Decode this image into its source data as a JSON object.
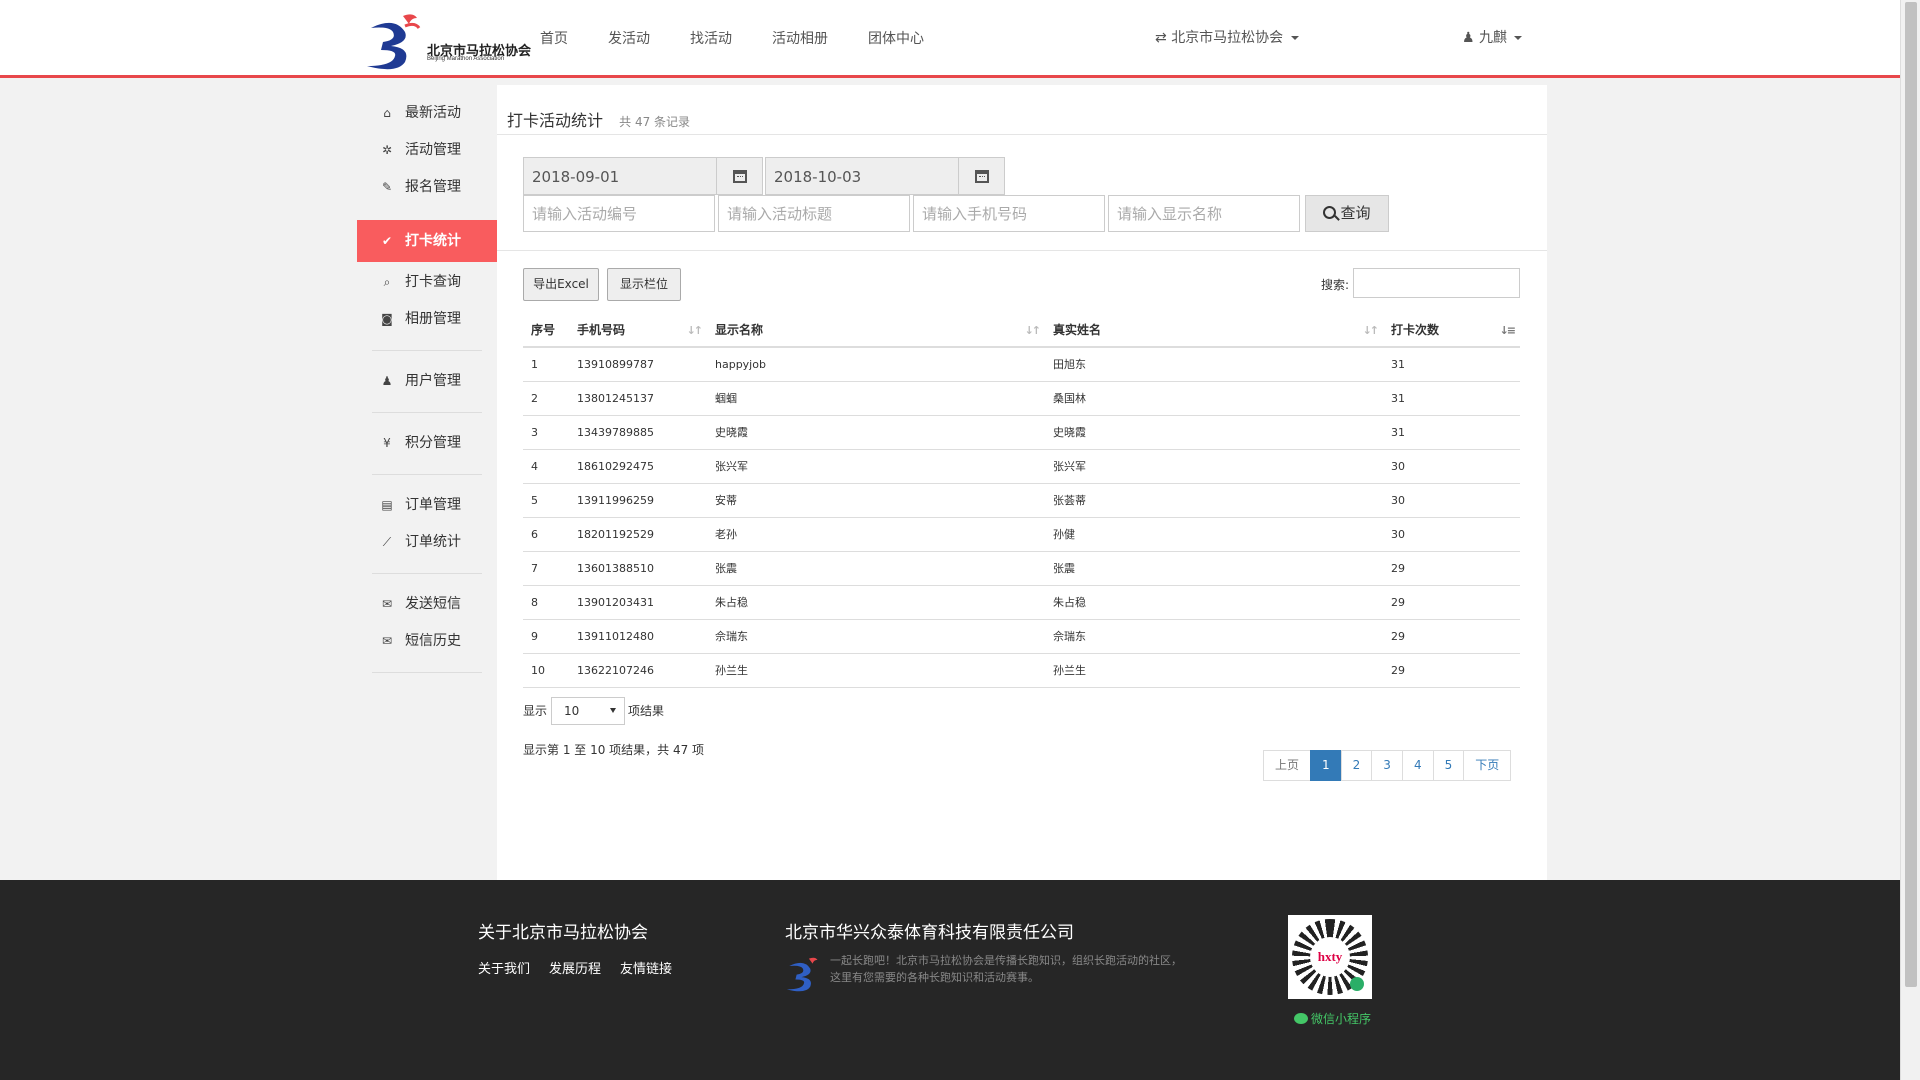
{
  "header": {
    "logo_cn": "北京市马拉松协会",
    "logo_en": "Beijing Marathon Association",
    "nav": [
      "首页",
      "发活动",
      "找活动",
      "活动相册",
      "团体中心"
    ],
    "org_switch": "北京市马拉松协会",
    "user": "九麒"
  },
  "sidebar": {
    "items": [
      {
        "label": "最新活动",
        "icon": "home-icon",
        "glyph": "⌂"
      },
      {
        "label": "活动管理",
        "icon": "gear-icon",
        "glyph": "✲"
      },
      {
        "label": "报名管理",
        "icon": "edit-icon",
        "glyph": "✎"
      },
      {
        "label": "打卡统计",
        "icon": "check-square-icon",
        "glyph": "✔"
      },
      {
        "label": "打卡查询",
        "icon": "search-icon",
        "glyph": "⌕"
      },
      {
        "label": "相册管理",
        "icon": "camera-icon",
        "glyph": "◙"
      },
      {
        "label": "用户管理",
        "icon": "user-icon",
        "glyph": "♟"
      },
      {
        "label": "积分管理",
        "icon": "yen-icon",
        "glyph": "¥"
      },
      {
        "label": "订单管理",
        "icon": "file-icon",
        "glyph": "▤"
      },
      {
        "label": "订单统计",
        "icon": "line-chart-icon",
        "glyph": "⟋"
      },
      {
        "label": "发送短信",
        "icon": "envelope-icon",
        "glyph": "✉"
      },
      {
        "label": "短信历史",
        "icon": "envelope-o-icon",
        "glyph": "✉"
      }
    ]
  },
  "panel": {
    "title": "打卡活动统计",
    "subtitle": "共 47 条记录"
  },
  "filters": {
    "start_date": "2018-09-01",
    "end_date": "2018-10-03",
    "ph_activity_no": "请输入活动编号",
    "ph_activity_title": "请输入活动标题",
    "ph_phone": "请输入手机号码",
    "ph_display_name": "请输入显示名称",
    "query": "查询"
  },
  "toolbar": {
    "export": "导出Excel",
    "columns": "显示栏位",
    "search_label": "搜索:"
  },
  "table": {
    "headers": [
      "序号",
      "手机号码",
      "显示名称",
      "真实姓名",
      "打卡次数"
    ],
    "rows": [
      [
        "1",
        "13910899787",
        "happyjob",
        "田旭东",
        "31"
      ],
      [
        "2",
        "13801245137",
        "蝈蝈",
        "桑国林",
        "31"
      ],
      [
        "3",
        "13439789885",
        "史晓霞",
        "史晓霞",
        "31"
      ],
      [
        "4",
        "18610292475",
        "张兴军",
        "张兴军",
        "30"
      ],
      [
        "5",
        "13911996259",
        "安蒂",
        "张荟蒂",
        "30"
      ],
      [
        "6",
        "18201192529",
        "老孙",
        "孙健",
        "30"
      ],
      [
        "7",
        "13601388510",
        "张震",
        "张震",
        "29"
      ],
      [
        "8",
        "13901203431",
        "朱占稳",
        "朱占稳",
        "29"
      ],
      [
        "9",
        "13911012480",
        "佘瑞东",
        "佘瑞东",
        "29"
      ],
      [
        "10",
        "13622107246",
        "孙兰生",
        "孙兰生",
        "29"
      ]
    ]
  },
  "length": {
    "prefix": "显示",
    "value": "10",
    "suffix": "项结果"
  },
  "info": "显示第 1 至 10 项结果，共 47 项",
  "pager": {
    "prev": "上页",
    "pages": [
      "1",
      "2",
      "3",
      "4",
      "5"
    ],
    "current": "1",
    "next": "下页"
  },
  "footer": {
    "col1_title": "关于北京市马拉松协会",
    "links": [
      "关于我们",
      "发展历程",
      "友情链接"
    ],
    "col2_title": "北京市华兴众泰体育科技有限责任公司",
    "desc": "一起长跑吧！北京市马拉松协会是传播长跑知识，组织长跑活动的社区，这里有您需要的各种长跑知识和活动赛事。",
    "qr_text": "hxty",
    "mini_program": "微信小程序"
  },
  "colors": {
    "accent": "#f95c5e",
    "header_line": "#e8474b",
    "link": "#337ab7",
    "footer_bg": "#262626"
  }
}
